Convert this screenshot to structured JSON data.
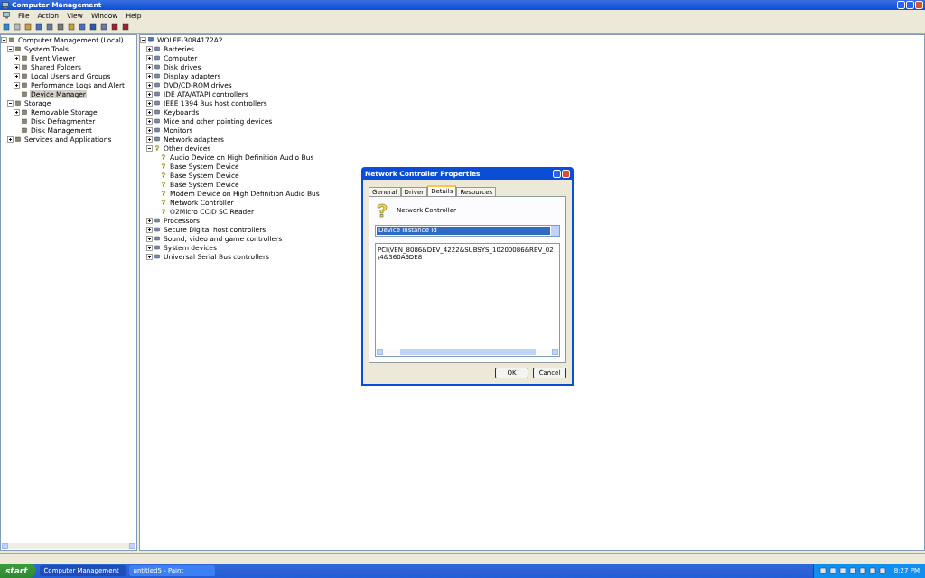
{
  "window": {
    "title": "Computer Management"
  },
  "menu": [
    "File",
    "Action",
    "View",
    "Window",
    "Help"
  ],
  "left_tree": [
    {
      "label": "Computer Management (Local)",
      "selected": false,
      "expanded": true,
      "children": [
        {
          "label": "System Tools",
          "selected": false,
          "expanded": true,
          "children": [
            {
              "label": "Event Viewer",
              "selected": false,
              "expanded": false
            },
            {
              "label": "Shared Folders",
              "selected": false,
              "expanded": false
            },
            {
              "label": "Local Users and Groups",
              "selected": false,
              "expanded": false
            },
            {
              "label": "Performance Logs and Alert",
              "selected": false,
              "expanded": false
            },
            {
              "label": "Device Manager",
              "selected": true
            }
          ]
        },
        {
          "label": "Storage",
          "selected": false,
          "expanded": true,
          "children": [
            {
              "label": "Removable Storage",
              "selected": false,
              "expanded": false
            },
            {
              "label": "Disk Defragmenter",
              "selected": false
            },
            {
              "label": "Disk Management",
              "selected": false
            }
          ]
        },
        {
          "label": "Services and Applications",
          "selected": false,
          "expanded": false
        }
      ]
    }
  ],
  "device_tree": [
    {
      "label": "WOLFE-3084172A2",
      "kind": "computer",
      "expanded": true,
      "children": [
        {
          "label": "Batteries",
          "kind": "device",
          "expanded": false
        },
        {
          "label": "Computer",
          "kind": "device",
          "expanded": false
        },
        {
          "label": "Disk drives",
          "kind": "device",
          "expanded": false
        },
        {
          "label": "Display adapters",
          "kind": "device",
          "expanded": false
        },
        {
          "label": "DVD/CD-ROM drives",
          "kind": "device",
          "expanded": false
        },
        {
          "label": "IDE ATA/ATAPI controllers",
          "kind": "device",
          "expanded": false
        },
        {
          "label": "IEEE 1394 Bus host controllers",
          "kind": "device",
          "expanded": false
        },
        {
          "label": "Keyboards",
          "kind": "device",
          "expanded": false
        },
        {
          "label": "Mice and other pointing devices",
          "kind": "device",
          "expanded": false
        },
        {
          "label": "Monitors",
          "kind": "device",
          "expanded": false
        },
        {
          "label": "Network adapters",
          "kind": "device",
          "expanded": false
        },
        {
          "label": "Other devices",
          "kind": "unknown",
          "expanded": true,
          "children": [
            {
              "label": "Audio Device on High Definition Audio Bus",
              "kind": "unknown"
            },
            {
              "label": "Base System Device",
              "kind": "unknown"
            },
            {
              "label": "Base System Device",
              "kind": "unknown"
            },
            {
              "label": "Base System Device",
              "kind": "unknown"
            },
            {
              "label": "Modem Device on High Definition Audio Bus",
              "kind": "unknown"
            },
            {
              "label": "Network Controller",
              "kind": "unknown"
            },
            {
              "label": "O2Micro CCID SC Reader",
              "kind": "unknown"
            }
          ]
        },
        {
          "label": "Processors",
          "kind": "device",
          "expanded": false
        },
        {
          "label": "Secure Digital host controllers",
          "kind": "device",
          "expanded": false
        },
        {
          "label": "Sound, video and game controllers",
          "kind": "device",
          "expanded": false
        },
        {
          "label": "System devices",
          "kind": "device",
          "expanded": false
        },
        {
          "label": "Universal Serial Bus controllers",
          "kind": "device",
          "expanded": false
        }
      ]
    }
  ],
  "dialog": {
    "title": "Network Controller Properties",
    "tabs": [
      {
        "label": "General",
        "selected": false
      },
      {
        "label": "Driver",
        "selected": false
      },
      {
        "label": "Details",
        "selected": true
      },
      {
        "label": "Resources",
        "selected": false
      }
    ],
    "device_name": "Network Controller",
    "property": {
      "value": "Device Instance Id"
    },
    "values": [
      "PCI\\VEN_8086&DEV_4222&SUBSYS_10200086&REV_02\\4&360A6DE8"
    ],
    "buttons": [
      "OK",
      "Cancel"
    ]
  },
  "taskbar": {
    "start": "start",
    "tasks": [
      {
        "label": "Computer Management",
        "selected": true
      },
      {
        "label": "untitled5 - Paint",
        "selected": false
      }
    ],
    "clock": "8:27 PM"
  }
}
